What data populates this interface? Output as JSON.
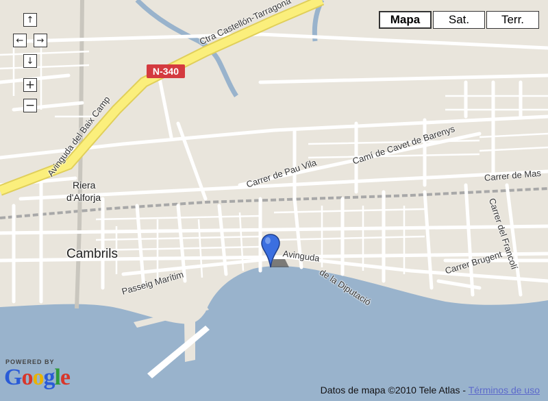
{
  "controls": {
    "pan_up": "↑",
    "pan_left": "←",
    "pan_right": "→",
    "pan_down": "↓",
    "zoom_in": "+",
    "zoom_out": "−"
  },
  "map_types": [
    {
      "label": "Mapa",
      "active": true
    },
    {
      "label": "Sat.",
      "active": false
    },
    {
      "label": "Terr.",
      "active": false
    }
  ],
  "road_shield": "N-340",
  "street_labels": {
    "ctra": "Ctra Castellón-Tarragona",
    "baix_camp": "Avinguda del Baix Camp",
    "pau_vila": "Carrer de Pau Vila",
    "cavet": "Camí de Cavet de Barenys",
    "masia": "Carrer de Mas",
    "francoli": "Carrer del Francolí",
    "brugent": "Carrer Brugent",
    "diputacio_1": "Avinguda",
    "diputacio_2": "de la Diputació",
    "passeig": "Passeig Marítim"
  },
  "places": {
    "riera_1": "Riera",
    "riera_2": "d'Alforja",
    "cambrils": "Cambrils"
  },
  "attribution": {
    "powered_by": "POWERED BY",
    "logo": {
      "G": "G",
      "o1": "o",
      "o2": "o",
      "g": "g",
      "l": "l",
      "e": "e"
    },
    "data_text": "Datos de mapa ©2010 Tele Atlas - ",
    "terms_link": "Términos de uso"
  },
  "colors": {
    "land": "#e9e5dc",
    "water": "#99b3cc",
    "highway": "#fbef7c",
    "shield": "#d43a3f",
    "marker": "#3b6fe0"
  },
  "icons": {
    "marker": "map-pin-icon"
  }
}
